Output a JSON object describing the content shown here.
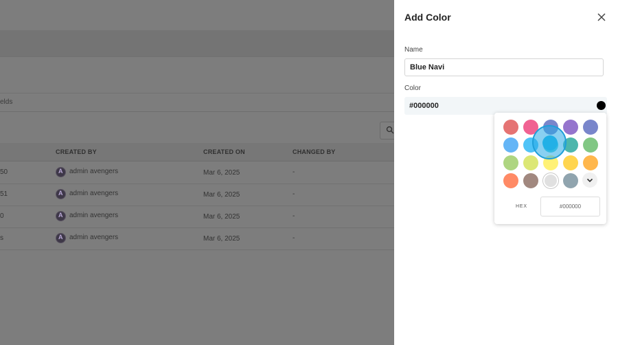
{
  "background": {
    "tab_fragment": "elds",
    "table": {
      "headers": [
        "CREATED BY",
        "CREATED ON",
        "CHANGED BY"
      ],
      "rows": [
        {
          "lead": "50",
          "created_by": "admin avengers",
          "created_on": "Mar 6, 2025",
          "changed_by": "-"
        },
        {
          "lead": "51",
          "created_by": "admin avengers",
          "created_on": "Mar 6, 2025",
          "changed_by": "-"
        },
        {
          "lead": "0",
          "created_by": "admin avengers",
          "created_on": "Mar 6, 2025",
          "changed_by": "-"
        },
        {
          "lead": "s",
          "created_by": "admin avengers",
          "created_on": "Mar 6, 2025",
          "changed_by": "-"
        }
      ],
      "avatar_letter": "A"
    }
  },
  "drawer": {
    "title": "Add Color",
    "close_icon": "close-icon",
    "name_label": "Name",
    "name_value": "Blue Navi",
    "color_label": "Color",
    "color_value": "#000000",
    "color_swatch": "#000000"
  },
  "picker": {
    "swatches": [
      "#e57373",
      "#f06292",
      "#7986cb",
      "#9575cd",
      "#7986cb",
      "#64b5f6",
      "#4fc3f7",
      "#4dd0e1",
      "#4db6ac",
      "#81c784",
      "#aed581",
      "#dce775",
      "#fff176",
      "#ffd54f",
      "#ffb74d",
      "#ff8a65",
      "#a1887f",
      "#e0e0e0",
      "#90a4ae"
    ],
    "more_icon": "chevron-down-icon",
    "hex_label": "HEX",
    "hex_value": "#000000"
  }
}
